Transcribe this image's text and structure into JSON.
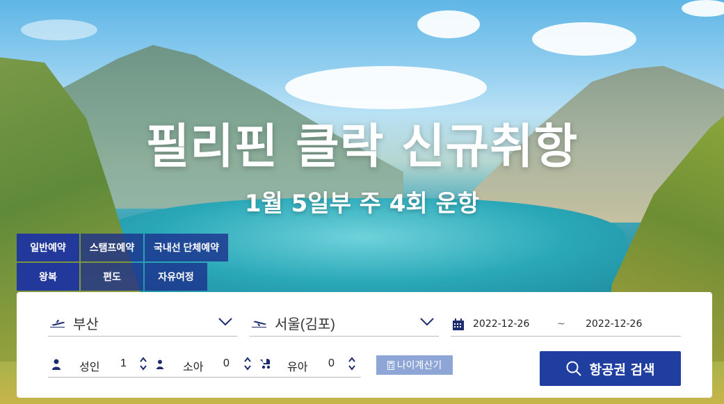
{
  "banner": {
    "headline": "필리핀 클락 신규취항",
    "subline": "1월 5일부 주 4회 운항"
  },
  "booking_type_tabs": [
    {
      "label": "일반예약",
      "active": true
    },
    {
      "label": "스탬프예약",
      "active": false
    },
    {
      "label": "국내선 단체예약",
      "active": false
    }
  ],
  "trip_type_tabs": [
    {
      "label": "왕복",
      "active": true
    },
    {
      "label": "편도",
      "active": false
    },
    {
      "label": "자유여정",
      "active": false
    }
  ],
  "search": {
    "origin": "부산",
    "destination": "서울(김포)",
    "depart_date": "2022-12-26",
    "date_separator": "~",
    "return_date": "2022-12-26",
    "passengers": [
      {
        "label": "성인",
        "count": "1",
        "icon": "adult-icon"
      },
      {
        "label": "소아",
        "count": "0",
        "icon": "child-icon"
      },
      {
        "label": "유아",
        "count": "0",
        "icon": "stroller-icon"
      }
    ],
    "age_calculator_label": "나이계산기",
    "search_button_label": "항공권 검색"
  },
  "colors": {
    "primary": "#1f3ea0",
    "tab_active": "#22399b",
    "icon_navy": "#1b2d6e",
    "age_button": "#8ea6d6"
  }
}
